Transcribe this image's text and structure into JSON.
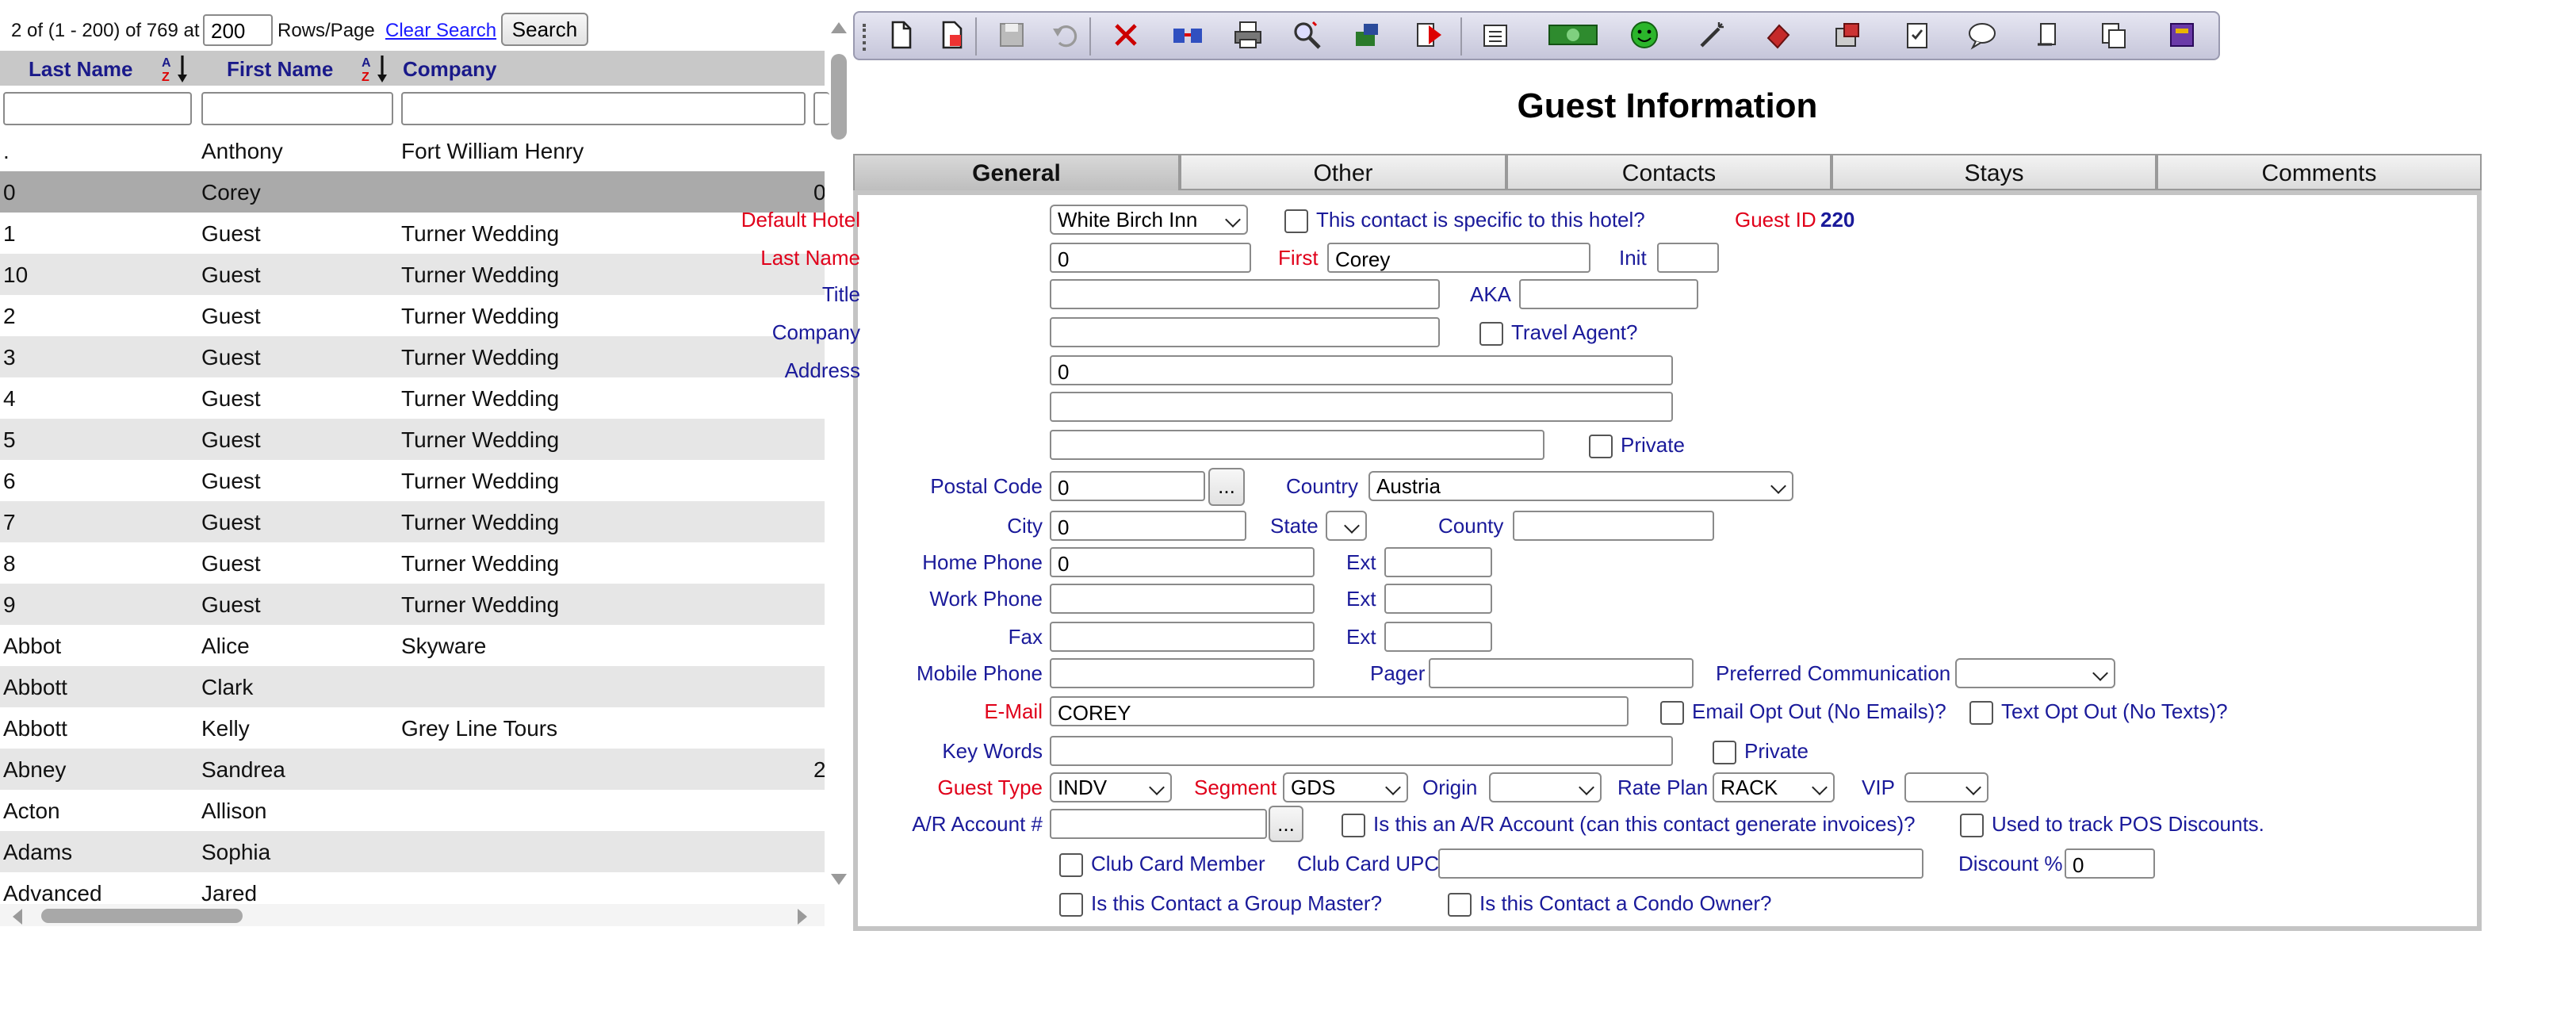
{
  "list": {
    "status_prefix": "2 of (1 - 200) of 769 at",
    "rows_per_page": "200",
    "rows_label": "Rows/Page",
    "clear_search": "Clear Search",
    "search": "Search",
    "headers": {
      "last": "Last Name",
      "first": "First Name",
      "company": "Company"
    },
    "rows": [
      {
        "last": ".",
        "first": "Anthony",
        "company": "Fort William Henry",
        "extra": ""
      },
      {
        "last": "0",
        "first": "Corey",
        "company": "",
        "extra": "0"
      },
      {
        "last": "1",
        "first": "Guest",
        "company": "Turner Wedding",
        "extra": ""
      },
      {
        "last": "10",
        "first": "Guest",
        "company": "Turner Wedding",
        "extra": ""
      },
      {
        "last": "2",
        "first": "Guest",
        "company": "Turner Wedding",
        "extra": ""
      },
      {
        "last": "3",
        "first": "Guest",
        "company": "Turner Wedding",
        "extra": ""
      },
      {
        "last": "4",
        "first": "Guest",
        "company": "Turner Wedding",
        "extra": ""
      },
      {
        "last": "5",
        "first": "Guest",
        "company": "Turner Wedding",
        "extra": ""
      },
      {
        "last": "6",
        "first": "Guest",
        "company": "Turner Wedding",
        "extra": ""
      },
      {
        "last": "7",
        "first": "Guest",
        "company": "Turner Wedding",
        "extra": ""
      },
      {
        "last": "8",
        "first": "Guest",
        "company": "Turner Wedding",
        "extra": ""
      },
      {
        "last": "9",
        "first": "Guest",
        "company": "Turner Wedding",
        "extra": ""
      },
      {
        "last": "Abbot",
        "first": "Alice",
        "company": "Skyware",
        "extra": ""
      },
      {
        "last": "Abbott",
        "first": "Clark",
        "company": "",
        "extra": ""
      },
      {
        "last": "Abbott",
        "first": "Kelly",
        "company": "Grey Line Tours",
        "extra": ""
      },
      {
        "last": "Abney",
        "first": "Sandrea",
        "company": "",
        "extra": "2"
      },
      {
        "last": "Acton",
        "first": "Allison",
        "company": "",
        "extra": ""
      },
      {
        "last": "Adams",
        "first": "Sophia",
        "company": "",
        "extra": ""
      },
      {
        "last": "Advanced",
        "first": "Jared",
        "company": "",
        "extra": ""
      }
    ]
  },
  "toolbar_icons": [
    "new-document-icon",
    "copy-document-icon",
    "save-icon",
    "undo-icon",
    "delete-icon",
    "merge-icon",
    "print-icon",
    "search-zoom-icon",
    "puzzle-icon",
    "export-icon",
    "report-icon",
    "money-icon",
    "smiley-icon",
    "magic-wand-icon",
    "eraser-icon",
    "package-icon",
    "checklist-icon",
    "comment-icon",
    "scroll-icon",
    "copy-clipboard-icon",
    "book-icon"
  ],
  "form": {
    "title": "Guest Information",
    "tabs": [
      "General",
      "Other",
      "Contacts",
      "Stays",
      "Comments"
    ],
    "labels": {
      "default_hotel": "Default Hotel",
      "specific_hotel": "This contact is specific to this hotel?",
      "guest_id": "Guest ID",
      "last_name": "Last Name",
      "first": "First",
      "init": "Init",
      "title": "Title",
      "aka": "AKA",
      "company": "Company",
      "travel_agent": "Travel Agent?",
      "address": "Address",
      "private": "Private",
      "postal_code": "Postal Code",
      "country": "Country",
      "city": "City",
      "state": "State",
      "county": "County",
      "home_phone": "Home Phone",
      "ext": "Ext",
      "work_phone": "Work Phone",
      "fax": "Fax",
      "mobile_phone": "Mobile Phone",
      "pager": "Pager",
      "preferred_comm": "Preferred Communication",
      "email": "E-Mail",
      "email_opt_out": "Email Opt Out (No Emails)?",
      "text_opt_out": "Text Opt Out (No Texts)?",
      "key_words": "Key Words",
      "guest_type": "Guest Type",
      "segment": "Segment",
      "origin": "Origin",
      "rate_plan": "Rate Plan",
      "vip": "VIP",
      "ar_account": "A/R Account #",
      "is_ar": "Is this an A/R Account (can this contact generate invoices)?",
      "pos_discounts": "Used to track POS Discounts.",
      "club_member": "Club Card Member",
      "club_upc": "Club Card UPC",
      "discount": "Discount %",
      "group_master": "Is this Contact a Group Master?",
      "condo_owner": "Is this Contact a Condo Owner?",
      "ellipsis": "..."
    },
    "values": {
      "default_hotel": "White Birch Inn",
      "guest_id": "220",
      "last_name": "0",
      "first": "Corey",
      "address1": "0",
      "postal_code": "0",
      "country": "Austria",
      "city": "0",
      "home_phone": "0",
      "email": "COREY",
      "guest_type": "INDV",
      "segment": "GDS",
      "rate_plan": "RACK",
      "discount": "0"
    }
  }
}
